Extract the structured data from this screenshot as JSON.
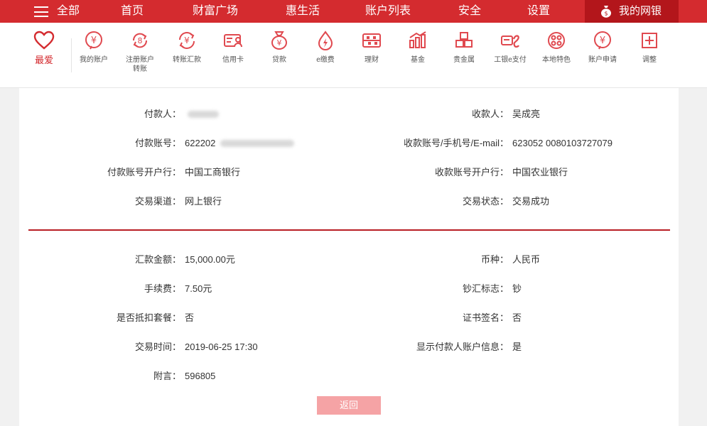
{
  "nav": {
    "all_label": "全部",
    "items": [
      "首页",
      "财富广场",
      "惠生活",
      "账户列表",
      "安全",
      "设置"
    ],
    "mybank_label": "我的网银"
  },
  "toolbar": {
    "favorite_label": "最爱",
    "items": [
      {
        "label": "我的账户",
        "icon": "yuan-circle-icon"
      },
      {
        "label": "注册账户\n转账",
        "icon": "register-transfer-icon"
      },
      {
        "label": "转账汇款",
        "icon": "transfer-icon"
      },
      {
        "label": "信用卡",
        "icon": "credit-card-icon"
      },
      {
        "label": "贷款",
        "icon": "money-bag-icon"
      },
      {
        "label": "e缴费",
        "icon": "drop-bolt-icon"
      },
      {
        "label": "理财",
        "icon": "abacus-icon"
      },
      {
        "label": "基金",
        "icon": "chart-bars-icon"
      },
      {
        "label": "贵金属",
        "icon": "gold-bars-icon"
      },
      {
        "label": "工银e支付",
        "icon": "e-pay-icon"
      },
      {
        "label": "本地特色",
        "icon": "local-feature-icon"
      },
      {
        "label": "账户申请",
        "icon": "account-apply-icon"
      },
      {
        "label": "调整",
        "icon": "plus-box-icon"
      }
    ]
  },
  "details": {
    "payer_label": "付款人：",
    "payer_value": "",
    "payee_label": "收款人：",
    "payee_value": "吴成亮",
    "payer_account_label": "付款账号：",
    "payer_account_value": "622202",
    "payee_account_label": "收款账号/手机号/E-mail：",
    "payee_account_value": "623052 0080103727079",
    "payer_bank_label": "付款账号开户行：",
    "payer_bank_value": "中国工商银行",
    "payee_bank_label": "收款账号开户行：",
    "payee_bank_value": "中国农业银行",
    "channel_label": "交易渠道：",
    "channel_value": "网上银行",
    "status_label": "交易状态：",
    "status_value": "交易成功",
    "amount_label": "汇款金额：",
    "amount_value": "15,000.00元",
    "currency_label": "币种：",
    "currency_value": "人民币",
    "fee_label": "手续费：",
    "fee_value": "7.50元",
    "cash_flag_label": "钞汇标志：",
    "cash_flag_value": "钞",
    "package_label": "是否抵扣套餐：",
    "package_value": "否",
    "cert_label": "证书签名：",
    "cert_value": "否",
    "time_label": "交易时间：",
    "time_value": "2019-06-25 17:30",
    "show_payer_label": "显示付款人账户信息：",
    "show_payer_value": "是",
    "note_label": "附言：",
    "note_value": "596805"
  },
  "back_button_label": "返回",
  "colors": {
    "brand_red": "#d42b2f",
    "dark_red": "#b3161b",
    "button_pink": "#f5a3a5"
  }
}
